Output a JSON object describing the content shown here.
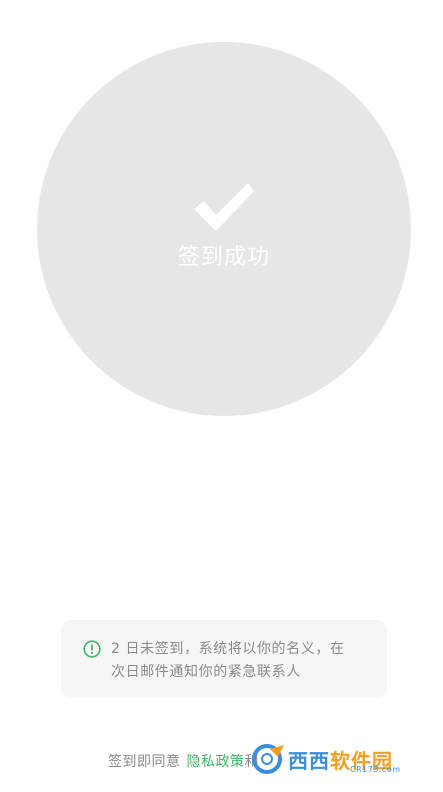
{
  "checkin": {
    "status_label": "签到成功",
    "icon": "checkmark-icon"
  },
  "notice": {
    "icon": "info-circle-icon",
    "line1": "2 日未签到，系统将以你的名义，在",
    "line2": "次日邮件通知你的紧急联系人"
  },
  "agreement": {
    "prefix": "签到即同意",
    "privacy_link": "隐私政策",
    "conjunction": "和"
  },
  "watermark": {
    "brand_a": "西西",
    "brand_b": "软件园",
    "site": "CR173.com"
  },
  "colors": {
    "circle": "#e6e6e6",
    "accent_green": "#3cb96a",
    "notice_bg": "#f6f6f6",
    "muted_text": "#8a8a8a"
  }
}
